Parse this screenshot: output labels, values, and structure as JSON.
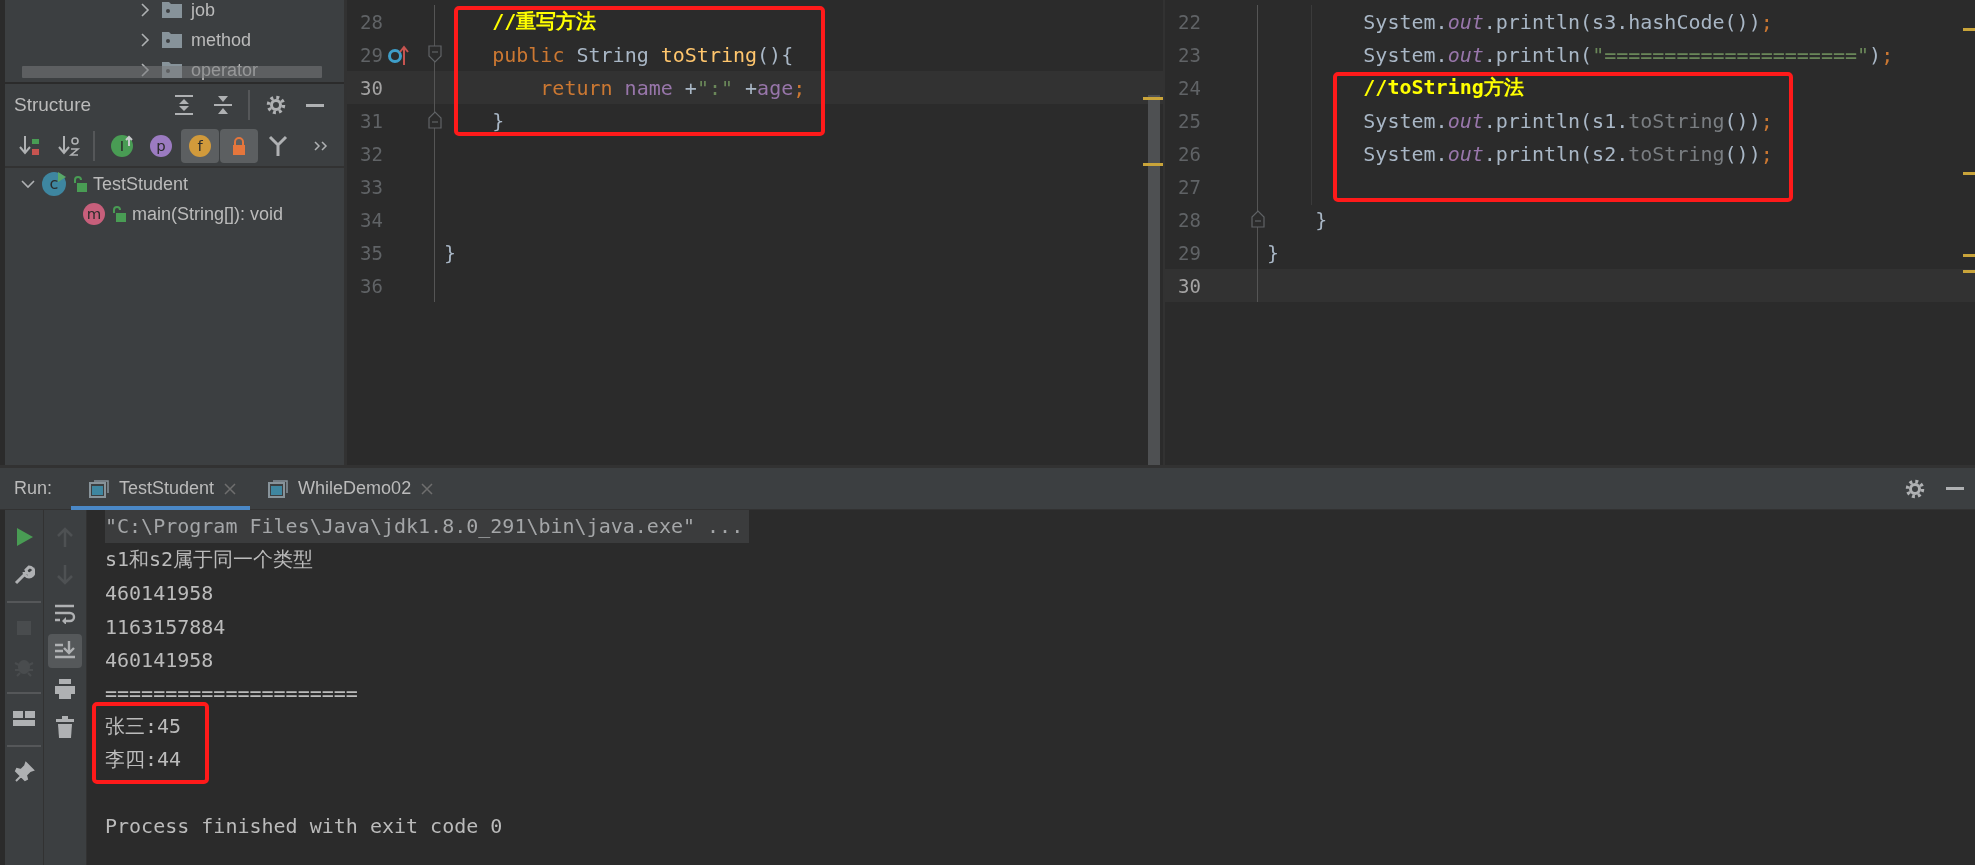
{
  "project_tree": [
    {
      "label": "job"
    },
    {
      "label": "method"
    },
    {
      "label": "operator"
    }
  ],
  "structure": {
    "title": "Structure",
    "header_tools": [
      {
        "kind": "expand-all"
      },
      {
        "kind": "collapse-all"
      },
      {
        "kind": "separator"
      },
      {
        "kind": "settings"
      },
      {
        "kind": "minimize"
      }
    ],
    "toolbar": [
      {
        "kind": "sort-visibility",
        "selected": false
      },
      {
        "kind": "sort-alpha",
        "selected": false
      },
      {
        "kind": "separator"
      },
      {
        "kind": "inherited",
        "glyph": "I",
        "selected": false
      },
      {
        "kind": "properties",
        "glyph": "p",
        "selected": false
      },
      {
        "kind": "fields",
        "glyph": "f",
        "selected": true
      },
      {
        "kind": "non-public",
        "selected": true
      },
      {
        "kind": "lambdas",
        "selected": false
      },
      {
        "kind": "more"
      }
    ],
    "tree": [
      {
        "label": "TestStudent",
        "kind": "class",
        "glyph": "c",
        "expanded": true,
        "children": [
          {
            "label": "main(String[]): void",
            "kind": "method",
            "glyph": "m"
          }
        ]
      }
    ]
  },
  "editors": [
    {
      "lines": [
        {
          "number": "28",
          "tokens": [
            {
              "kind": "comment",
              "text": "    //重写方法"
            }
          ],
          "current": false,
          "boxed": true
        },
        {
          "number": "29",
          "gutter_marks": [
            {
              "kind": "override"
            },
            {
              "kind": "fold-start"
            }
          ],
          "tokens": [
            {
              "kind": "keyword",
              "text": "    public"
            },
            {
              "kind": "plain",
              "text": " String "
            },
            {
              "kind": "declaration",
              "text": "toString"
            },
            {
              "kind": "plain",
              "text": "(){"
            }
          ],
          "current": false,
          "boxed": true
        },
        {
          "number": "30",
          "tokens": [
            {
              "kind": "keyword",
              "text": "        return"
            },
            {
              "kind": "field",
              "text": " name"
            },
            {
              "kind": "plain",
              "text": " +"
            },
            {
              "kind": "string",
              "text": "\":\""
            },
            {
              "kind": "plain",
              "text": " +"
            },
            {
              "kind": "field",
              "text": "age"
            },
            {
              "kind": "punct",
              "text": ";"
            }
          ],
          "current": true,
          "boxed": true
        },
        {
          "number": "31",
          "gutter_marks": [
            {
              "kind": "fold-end"
            }
          ],
          "tokens": [
            {
              "kind": "plain",
              "text": "    }"
            }
          ],
          "current": false,
          "boxed": true
        },
        {
          "number": "32",
          "current": false,
          "boxed": false
        },
        {
          "number": "33",
          "current": false,
          "boxed": false
        },
        {
          "number": "34",
          "current": false,
          "boxed": false
        },
        {
          "number": "35",
          "tokens": [
            {
              "kind": "plain",
              "text": "}"
            }
          ],
          "current": false,
          "boxed": false
        },
        {
          "number": "36",
          "current": false,
          "boxed": false
        }
      ]
    },
    {
      "lines": [
        {
          "number": "22",
          "tokens": [
            {
              "kind": "plain",
              "text": "        System."
            },
            {
              "kind": "static",
              "text": "out"
            },
            {
              "kind": "plain",
              "text": ".println(s3.hashCode())"
            },
            {
              "kind": "punct",
              "text": ";"
            }
          ],
          "current": false,
          "boxed": false
        },
        {
          "number": "23",
          "tokens": [
            {
              "kind": "plain",
              "text": "        System."
            },
            {
              "kind": "static",
              "text": "out"
            },
            {
              "kind": "plain",
              "text": ".println("
            },
            {
              "kind": "string",
              "text": "\"=====================\""
            },
            {
              "kind": "plain",
              "text": ")"
            },
            {
              "kind": "punct",
              "text": ";"
            }
          ],
          "current": false,
          "boxed": false
        },
        {
          "number": "24",
          "tokens": [
            {
              "kind": "comment",
              "text": "        //toString方法"
            }
          ],
          "current": false,
          "boxed": true
        },
        {
          "number": "25",
          "tokens": [
            {
              "kind": "plain",
              "text": "        System."
            },
            {
              "kind": "static",
              "text": "out"
            },
            {
              "kind": "plain",
              "text": ".println(s1."
            },
            {
              "kind": "implicit",
              "text": "toString"
            },
            {
              "kind": "plain",
              "text": "())"
            },
            {
              "kind": "punct",
              "text": ";"
            }
          ],
          "current": false,
          "boxed": true
        },
        {
          "number": "26",
          "tokens": [
            {
              "kind": "plain",
              "text": "        System."
            },
            {
              "kind": "static",
              "text": "out"
            },
            {
              "kind": "plain",
              "text": ".println(s2."
            },
            {
              "kind": "implicit",
              "text": "toString"
            },
            {
              "kind": "plain",
              "text": "())"
            },
            {
              "kind": "punct",
              "text": ";"
            }
          ],
          "current": false,
          "boxed": true
        },
        {
          "number": "27",
          "current": false,
          "boxed": true
        },
        {
          "number": "28",
          "gutter_marks": [
            {
              "kind": "fold-end"
            }
          ],
          "tokens": [
            {
              "kind": "plain",
              "text": "    }"
            }
          ],
          "current": false,
          "boxed": false
        },
        {
          "number": "29",
          "tokens": [
            {
              "kind": "plain",
              "text": "}"
            }
          ],
          "current": false,
          "boxed": false
        },
        {
          "number": "30",
          "current": true,
          "boxed": false
        }
      ]
    }
  ],
  "run": {
    "label": "Run:",
    "tabs": [
      {
        "label": "TestStudent",
        "selected": true
      },
      {
        "label": "WhileDemo02",
        "selected": false
      }
    ],
    "panel_tools": [
      {
        "kind": "settings"
      },
      {
        "kind": "minimize"
      }
    ],
    "side_tools": [
      {
        "kind": "run",
        "disabled": false
      },
      {
        "kind": "wrench",
        "disabled": false
      },
      {
        "kind": "separator"
      },
      {
        "kind": "stop",
        "disabled": true
      },
      {
        "kind": "debug",
        "disabled": true
      },
      {
        "kind": "separator"
      },
      {
        "kind": "layout",
        "disabled": false
      },
      {
        "kind": "separator"
      },
      {
        "kind": "pin",
        "disabled": false
      }
    ],
    "console_tools": [
      {
        "kind": "up",
        "disabled": true,
        "selected": false
      },
      {
        "kind": "down",
        "disabled": true,
        "selected": false
      },
      {
        "kind": "wrap",
        "disabled": false,
        "selected": false
      },
      {
        "kind": "scroll-end",
        "disabled": false,
        "selected": true
      },
      {
        "kind": "print",
        "disabled": false,
        "selected": false
      },
      {
        "kind": "trash",
        "disabled": false,
        "selected": false
      }
    ],
    "console": [
      {
        "kind": "command",
        "text": "\"C:\\Program Files\\Java\\jdk1.8.0_291\\bin\\java.exe\" ...",
        "boxed": false
      },
      {
        "kind": "output",
        "text": "s1和s2属于同一个类型",
        "boxed": false
      },
      {
        "kind": "output",
        "text": "460141958",
        "boxed": false
      },
      {
        "kind": "output",
        "text": "1163157884",
        "boxed": false
      },
      {
        "kind": "output",
        "text": "460141958",
        "boxed": false
      },
      {
        "kind": "output",
        "text": "=====================",
        "boxed": false
      },
      {
        "kind": "output",
        "text": "张三:45",
        "boxed": true
      },
      {
        "kind": "output",
        "text": "李四:44",
        "boxed": true
      },
      {
        "kind": "gap"
      },
      {
        "kind": "exit",
        "text": "Process finished with exit code 0",
        "boxed": false
      }
    ]
  }
}
